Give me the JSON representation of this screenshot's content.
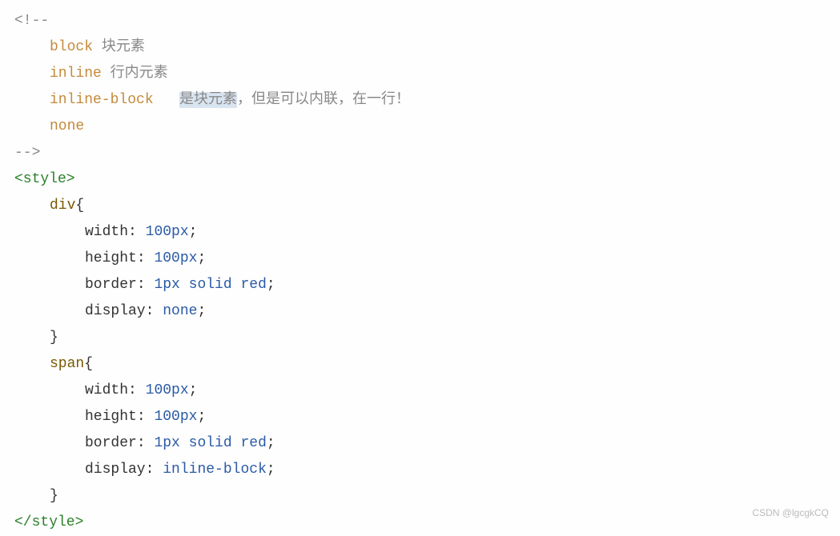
{
  "code": {
    "comment_open": "<!--",
    "l1_kw": "block",
    "l1_txt": " 块元素",
    "l2_kw": "inline",
    "l2_txt": " 行内元素",
    "l3_kw": "inline-block",
    "l3_gap": "   ",
    "l3_hl": "是块元素",
    "l3_txt": "，但是可以内联，在一行！",
    "l4_kw": "none",
    "comment_close": "-->",
    "style_open": "<style>",
    "sel_div": "div",
    "brace_open": "{",
    "p_width": "width",
    "v_100px": "100px",
    "p_height": "height",
    "p_border": "border",
    "v_1px": "1px",
    "v_solid": "solid",
    "v_red": "red",
    "p_display": "display",
    "v_none": "none",
    "brace_close": "}",
    "sel_span": "span",
    "v_inline_block": "inline-block",
    "style_close": "</style>",
    "colon": ":",
    "semi": ";",
    "sp": " "
  },
  "watermark": "CSDN @lgcgkCQ"
}
